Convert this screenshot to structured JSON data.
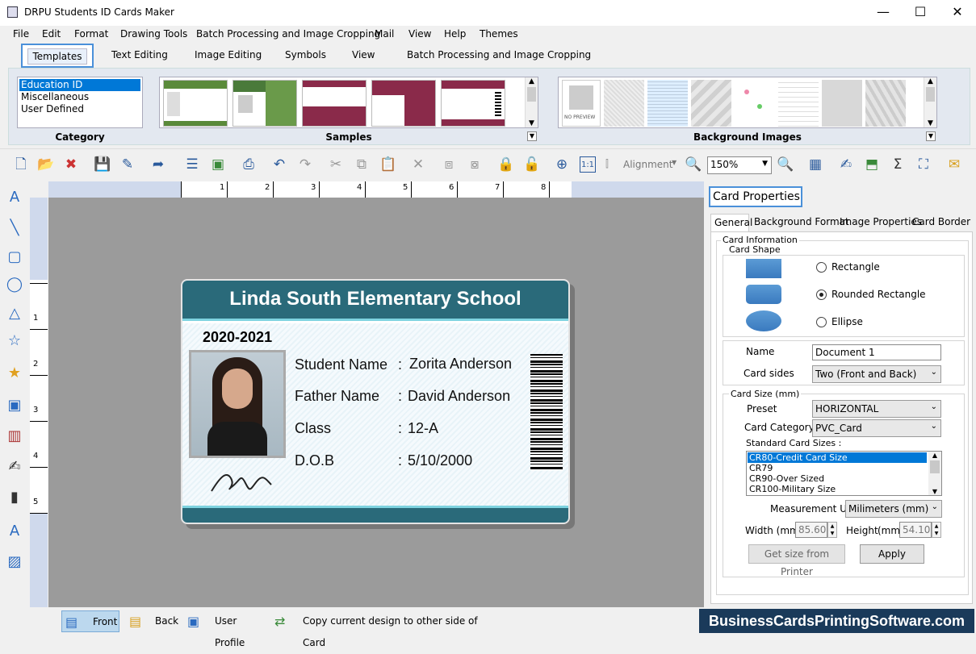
{
  "window": {
    "title": "DRPU Students ID Cards Maker",
    "min": "—",
    "max": "☐",
    "close": "✕"
  },
  "menu": [
    "File",
    "Edit",
    "Format",
    "Drawing Tools",
    "Batch Processing and Image Cropping",
    "Mail",
    "View",
    "Help",
    "Themes"
  ],
  "ribbon_tabs": [
    "Templates",
    "Text Editing",
    "Image Editing",
    "Symbols",
    "View",
    "Batch Processing and Image Cropping"
  ],
  "ribbon": {
    "category_label": "Category",
    "categories": [
      "Education ID",
      "Miscellaneous",
      "User Defined"
    ],
    "samples_label": "Samples",
    "bg_images_label": "Background Images",
    "no_preview": "NO PREVIEW"
  },
  "toolbar": {
    "alignment": "Alignment",
    "zoom": "150%"
  },
  "ruler": {
    "h": [
      "1",
      "2",
      "3",
      "4",
      "5",
      "6",
      "7",
      "8"
    ],
    "v": [
      "1",
      "2",
      "3",
      "4",
      "5"
    ]
  },
  "card": {
    "school": "Linda South  Elementary School",
    "year": "2020-2021",
    "fields": [
      {
        "label": "Student Name",
        "colon": ":",
        "value": "Zorita Anderson"
      },
      {
        "label": "Father Name",
        "colon": ":",
        "value": "David Anderson"
      },
      {
        "label": "Class",
        "colon": ":",
        "value": "12-A"
      },
      {
        "label": "D.O.B",
        "colon": ":",
        "value": "5/10/2000"
      }
    ]
  },
  "props": {
    "title": "Card Properties",
    "tabs": [
      "General",
      "Background Format",
      "Image Properties",
      "Card Border"
    ],
    "card_info": "Card Information",
    "card_shape": "Card Shape",
    "shapes": [
      "Rectangle",
      "Rounded Rectangle",
      "Ellipse"
    ],
    "selected_shape": "Rounded Rectangle",
    "name_label": "Name",
    "name_value": "Document 1",
    "sides_label": "Card sides",
    "sides_value": "Two (Front and Back)",
    "size_group": "Card Size (mm)",
    "preset_label": "Preset",
    "preset_value": "HORIZONTAL",
    "category_label": "Card Category",
    "category_value": "PVC_Card",
    "std_sizes_label": "Standard Card Sizes :",
    "std_sizes": [
      "CR80-Credit Card Size",
      "CR79",
      "CR90-Over Sized",
      "CR100-Military Size"
    ],
    "unit_label": "Measurement Unit :",
    "unit_value": "Milimeters (mm)",
    "width_label": "Width  (mm)",
    "width_value": "85.60",
    "height_label": "Height",
    "height_unit": "(mm)",
    "height_value": "54.10",
    "get_size_btn": "Get size from Printer",
    "apply_btn": "Apply"
  },
  "status": {
    "front": "Front",
    "back": "Back",
    "user_profile": "User Profile",
    "copy": "Copy current design to other side of Card",
    "watermark": "BusinessCardsPrintingSoftware.com"
  },
  "colors": {
    "card_header": "#2a6a7a",
    "accent": "#4a90d9",
    "selection": "#0078d7"
  }
}
